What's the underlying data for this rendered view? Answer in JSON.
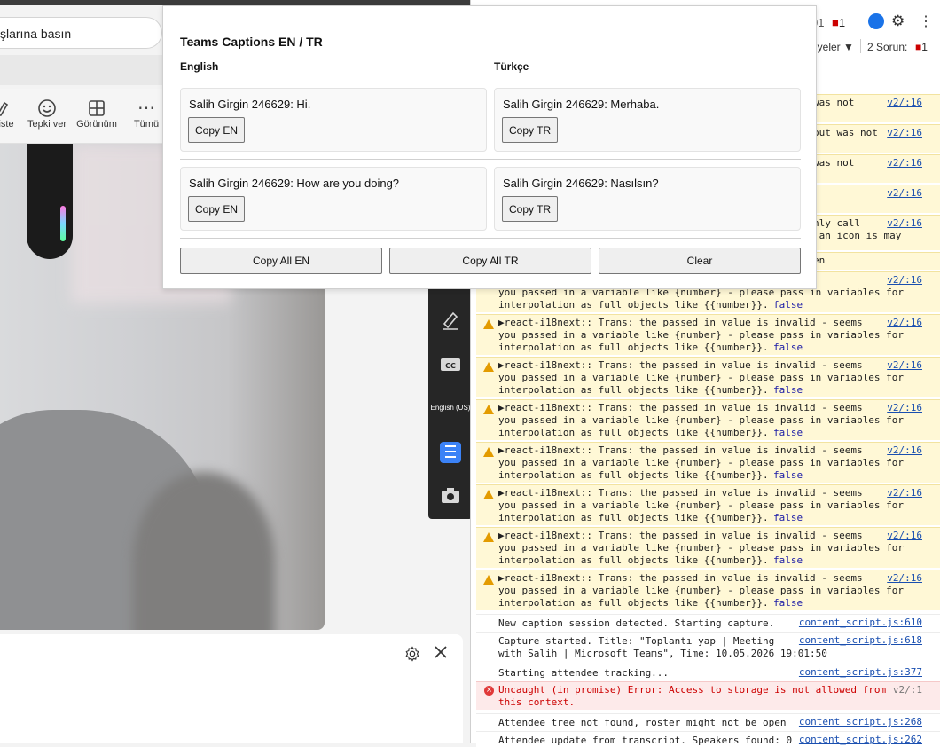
{
  "browser": {
    "address_text": "şlarına basın"
  },
  "teams_toolbar": {
    "items": [
      {
        "label": "iste",
        "icon": "hand-icon"
      },
      {
        "label": "Tepki ver",
        "icon": "smiley-icon"
      },
      {
        "label": "Görünüm",
        "icon": "grid-icon"
      },
      {
        "label": "Tümü",
        "icon": "more-icon"
      }
    ]
  },
  "rail": {
    "language_label": "English (US)"
  },
  "devtools": {
    "top_counter": "01",
    "error_badge": "1",
    "levels_label": "iyeler ▼",
    "issues_label": "2 Sorun:",
    "issues_count": "1",
    "partial_rows": [
      {
        "text": "was not",
        "src": "v2/:16"
      },
      {
        "text": "out was not",
        "src": "v2/:16"
      },
      {
        "text": "was not",
        "src": "v2/:16"
      },
      {
        "text": "",
        "src": "v2/:16"
      },
      {
        "text": "nly call\n an icon is may",
        "src": "v2/:16"
      },
      {
        "text": "en",
        "src": ""
      },
      {
        "text": "   - seems\nyou passed in a variable like {number} - please pass in variables for\ninterpolation as full objects like {{number}}.",
        "src": "v2/:16"
      }
    ],
    "warning_text": "▶react-i18next:: Trans: the passed in value is invalid - seems\nyou passed in a variable like {number} - please pass in variables for\ninterpolation as full objects like {{number}}.",
    "warning_false": "false",
    "warning_src": "v2/:16",
    "info_rows": [
      {
        "text": "New caption session detected. Starting capture.",
        "src": "content_script.js:610"
      },
      {
        "text": "Capture started. Title: \"Toplantı yap | Meeting\nwith Salih | Microsoft Teams\", Time: 10.05.2026 19:01:50",
        "src": "content_script.js:618"
      },
      {
        "text": "Starting attendee tracking...",
        "src": "content_script.js:377"
      }
    ],
    "error_row": {
      "text": "Uncaught (in promise) Error: Access to storage is not allowed from\nthis context.",
      "src": "v2/:1"
    },
    "tail_rows": [
      {
        "text": "Attendee tree not found, roster might not be open",
        "src": "content_script.js:268"
      },
      {
        "text": "Attendee update from transcript. Speakers found: 0",
        "src": "content_script.js:262"
      }
    ]
  },
  "popup": {
    "title": "Teams Captions EN / TR",
    "col_en": "English",
    "col_tr": "Türkçe",
    "rows": [
      {
        "en": "Salih Girgin 246629: Hi.",
        "tr": "Salih Girgin 246629: Merhaba."
      },
      {
        "en": "Salih Girgin 246629: How are you doing?",
        "tr": "Salih Girgin 246629: Nasılsın?"
      }
    ],
    "copy_en_label": "Copy EN",
    "copy_tr_label": "Copy TR",
    "copy_all_en_label": "Copy All EN",
    "copy_all_tr_label": "Copy All TR",
    "clear_label": "Clear"
  }
}
